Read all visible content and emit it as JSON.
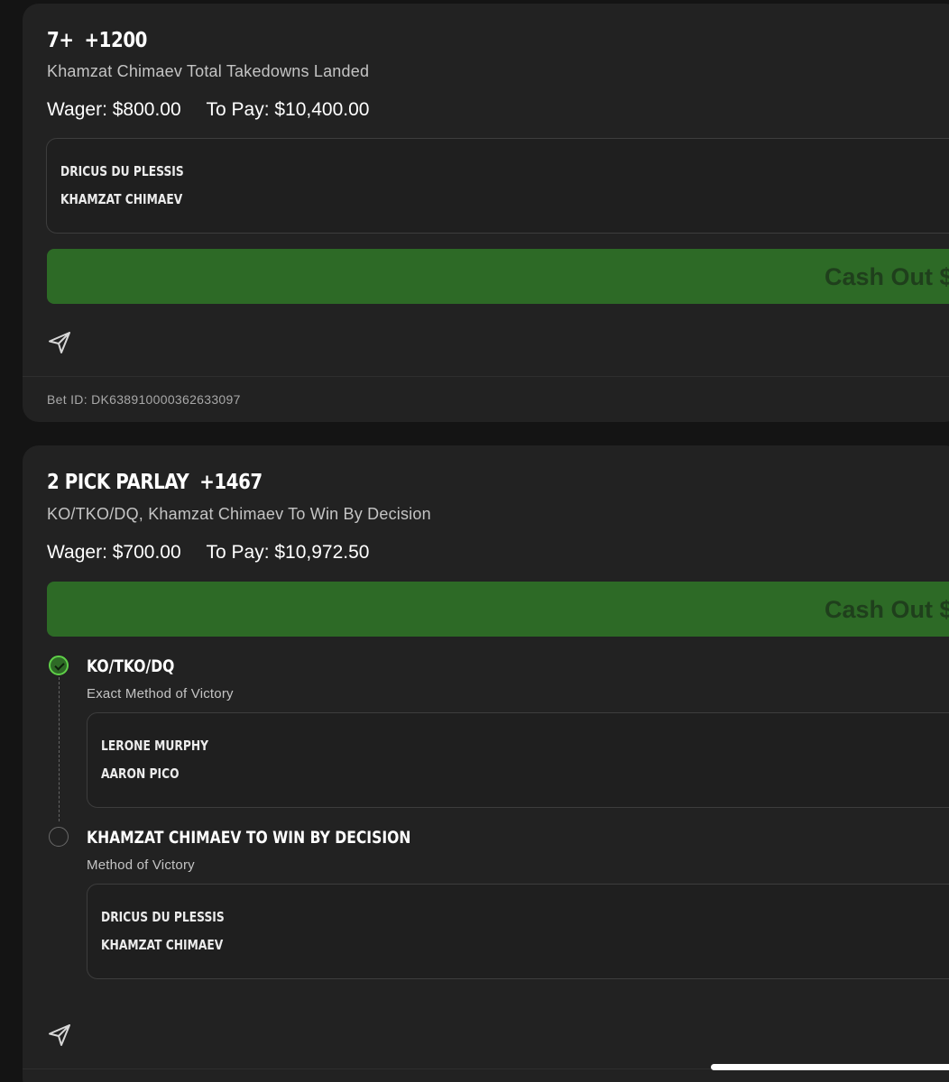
{
  "bets": [
    {
      "title": "7+",
      "odds": "+1200",
      "subtitle": "Khamzat Chimaev Total Takedowns Landed",
      "wager": "Wager: $800.00",
      "to_pay": "To Pay: $10,400.00",
      "matchup": {
        "fighter1": "DRICUS DU PLESSIS",
        "fighter2": "KHAMZAT CHIMAEV"
      },
      "cashout_label": "Cash Out $",
      "bet_id": "Bet ID: DK638910000362633097"
    },
    {
      "title": "2 PICK PARLAY",
      "odds": "+1467",
      "subtitle": "KO/TKO/DQ, Khamzat Chimaev To Win By Decision",
      "wager": "Wager: $700.00",
      "to_pay": "To Pay: $10,972.50",
      "cashout_label": "Cash Out $",
      "legs": [
        {
          "status": "won",
          "title": "KO/TKO/DQ",
          "market": "Exact Method of Victory",
          "matchup": {
            "fighter1": "LERONE MURPHY",
            "fighter2": "AARON PICO"
          }
        },
        {
          "status": "pending",
          "title": "KHAMZAT CHIMAEV TO WIN BY DECISION",
          "market": "Method of Victory",
          "matchup": {
            "fighter1": "DRICUS DU PLESSIS",
            "fighter2": "KHAMZAT CHIMAEV"
          }
        }
      ]
    }
  ],
  "colors": {
    "background": "#141414",
    "card": "#222222",
    "cashout_button": "#2d6a26",
    "cashout_text": "#1f3f1c",
    "leg_won": "#5fd048"
  },
  "icons": {
    "share": "send-paper-plane-icon",
    "leg_won": "check-circle-icon",
    "leg_pending": "empty-circle-icon"
  }
}
